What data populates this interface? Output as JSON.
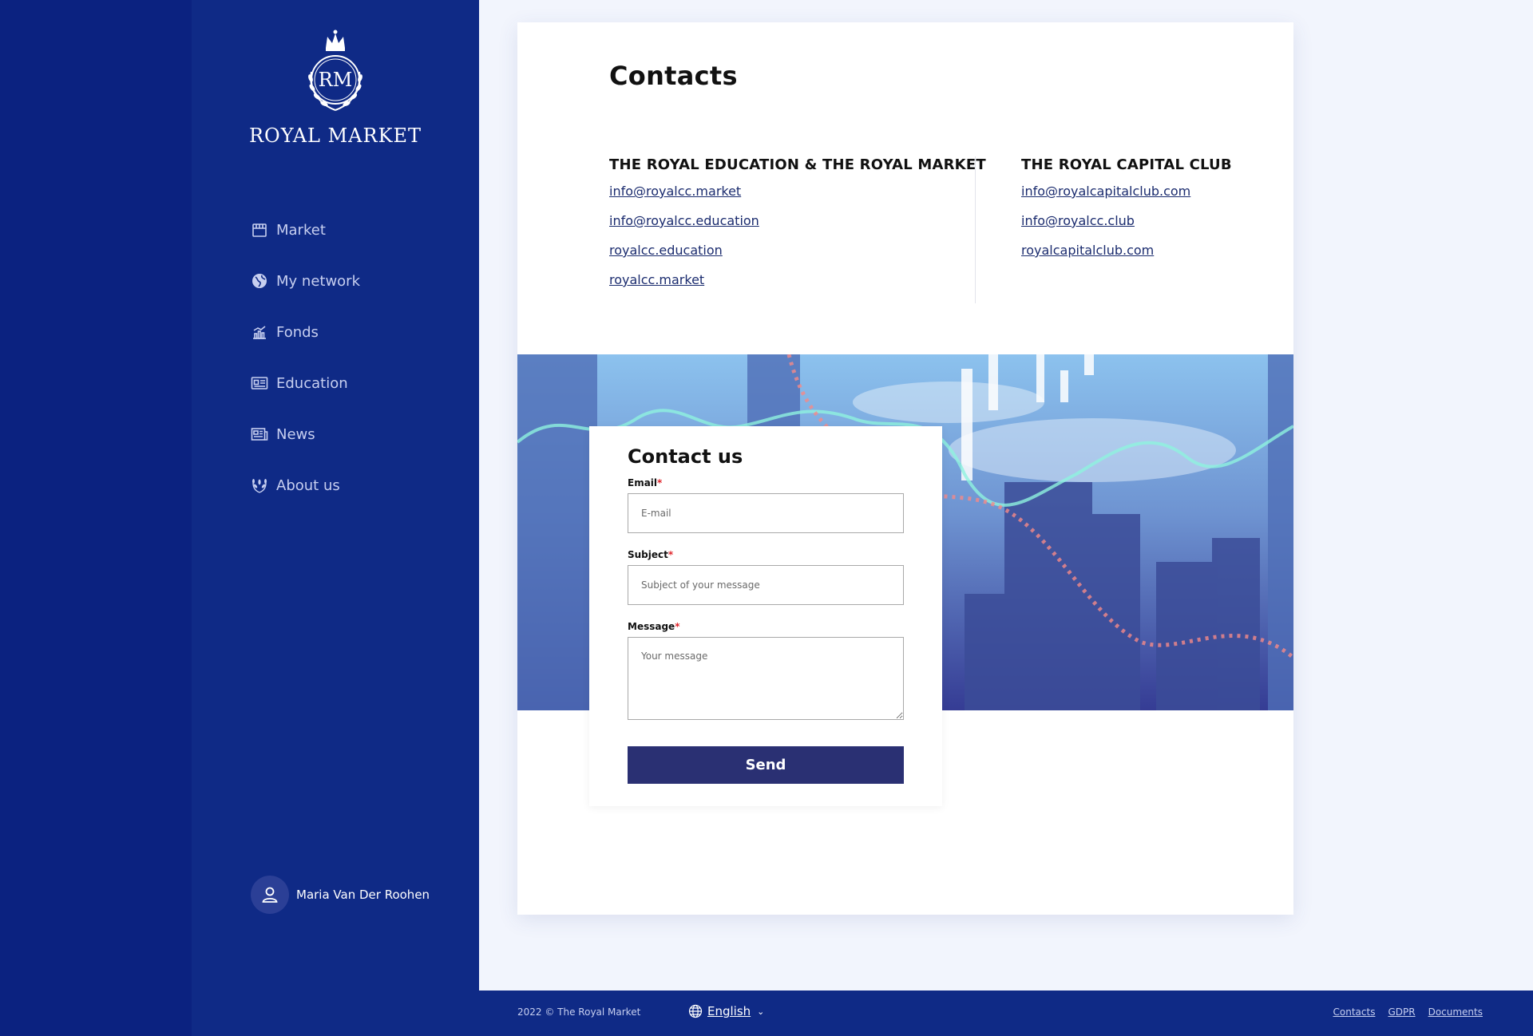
{
  "sidebar": {
    "logo_monogram": "RM",
    "brand": "ROYAL MARKET",
    "nav": [
      {
        "label": "Market",
        "icon": "store-icon"
      },
      {
        "label": "My network",
        "icon": "globe-icon"
      },
      {
        "label": "Fonds",
        "icon": "chart-icon"
      },
      {
        "label": "Education",
        "icon": "id-card-icon"
      },
      {
        "label": "News",
        "icon": "newspaper-icon"
      },
      {
        "label": "About us",
        "icon": "laurel-icon"
      }
    ],
    "user_name": "Maria Van Der Roohen"
  },
  "page": {
    "title": "Contacts",
    "columns": [
      {
        "title": "THE ROYAL EDUCATION & THE ROYAL MARKET",
        "links": [
          "info@royalcc.market",
          "info@royalcc.education",
          "royalcc.education",
          "royalcc.market"
        ]
      },
      {
        "title": "THE ROYAL CAPITAL CLUB",
        "links": [
          "info@royalcapitalclub.com",
          "info@royalcc.club",
          "royalcapitalclub.com"
        ]
      }
    ]
  },
  "form": {
    "title": "Contact us",
    "email_label": "Email",
    "email_placeholder": "E-mail",
    "subject_label": "Subject",
    "subject_placeholder": "Subject of your message",
    "message_label": "Message",
    "message_placeholder": "Your message",
    "required_mark": "*",
    "send_label": "Send"
  },
  "footer": {
    "copyright": "2022 © The Royal Market",
    "language": "English",
    "links": [
      "Contacts",
      "GDPR",
      "Documents"
    ]
  },
  "colors": {
    "sidebar": "#0f2a86",
    "left_strip": "#0b2280",
    "button": "#2a3073",
    "link": "#1a2b6e",
    "required": "#e0262c"
  }
}
